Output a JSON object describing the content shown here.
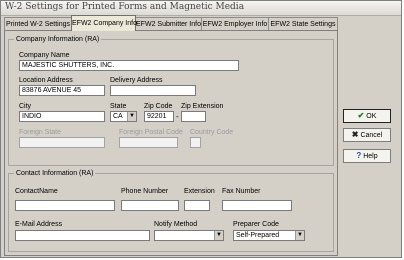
{
  "window": {
    "title": "W-2 Settings for Printed Forms and Magnetic Media"
  },
  "tabs": [
    {
      "label": "Printed W-2 Settings"
    },
    {
      "label": "EFW2 Company Info"
    },
    {
      "label": "EFW2 Submitter Info"
    },
    {
      "label": "EFW2 Employer Info"
    },
    {
      "label": "EFW2 State Settings"
    }
  ],
  "company": {
    "group_title": "Company Information (RA)",
    "company_name": {
      "label": "Company Name",
      "value": "MAJESTIC SHUTTERS, INC."
    },
    "location_address": {
      "label": "Location Address",
      "value": "83876 AVENUE 45"
    },
    "delivery_address": {
      "label": "Delivery Address",
      "value": ""
    },
    "city": {
      "label": "City",
      "value": "INDIO"
    },
    "state": {
      "label": "State",
      "value": "CA"
    },
    "zip_code": {
      "label": "Zip Code",
      "value": "92201"
    },
    "zip_extension": {
      "label": "Zip Extension",
      "value": ""
    },
    "zip_dash": "-",
    "foreign_state": {
      "label": "Foreign State",
      "value": ""
    },
    "foreign_postal_code": {
      "label": "Foreign Postal Code",
      "value": ""
    },
    "country_code": {
      "label": "Country Code",
      "value": ""
    }
  },
  "contact": {
    "group_title": "Contact Information (RA)",
    "contact_name": {
      "label": "ContactName",
      "value": ""
    },
    "phone_number": {
      "label": "Phone Number",
      "value": ""
    },
    "extension": {
      "label": "Extension",
      "value": ""
    },
    "fax_number": {
      "label": "Fax Number",
      "value": ""
    },
    "email": {
      "label": "E-Mail Address",
      "value": ""
    },
    "notify_method": {
      "label": "Notify Method",
      "value": ""
    },
    "preparer_code": {
      "label": "Preparer Code",
      "value": "Self-Prepared"
    }
  },
  "buttons": {
    "ok": {
      "label": "OK",
      "icon": "check-icon",
      "icon_glyph": "✔"
    },
    "cancel": {
      "label": "Cancel",
      "icon": "close-icon",
      "icon_glyph": "✖"
    },
    "help": {
      "label": "Help",
      "icon": "help-icon",
      "icon_glyph": "?"
    }
  },
  "colors": {
    "window_bg": "#d4d0c8",
    "active_tab_bg": "#ece9d8",
    "disabled_text": "#9c9c9c"
  }
}
